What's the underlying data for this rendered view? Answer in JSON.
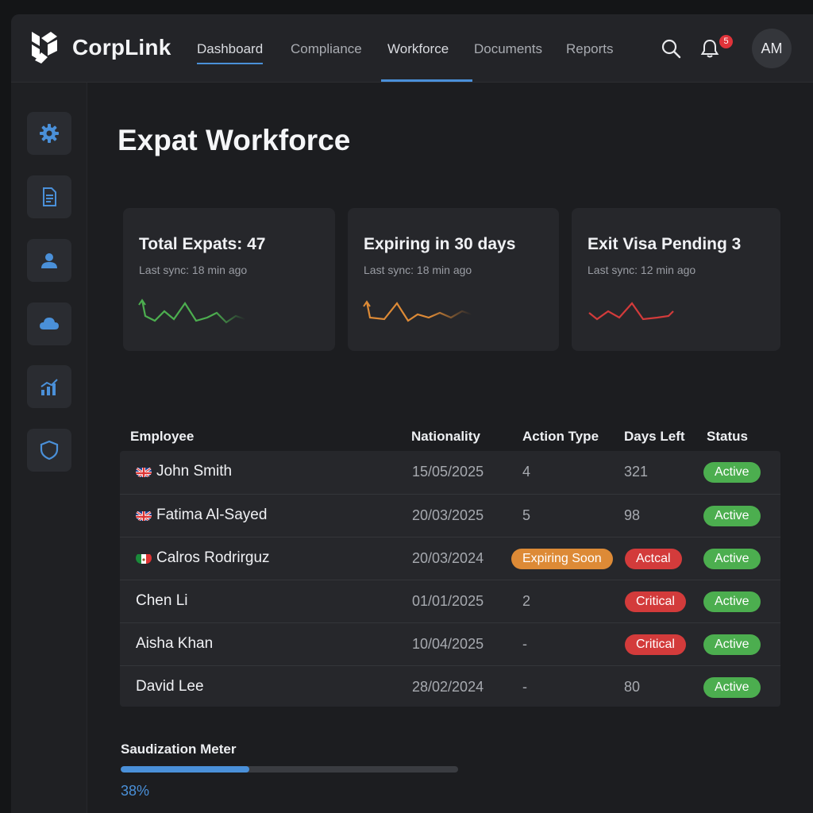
{
  "app": {
    "brand": "CorpLink"
  },
  "colors": {
    "accent": "#4a90d9",
    "green": "#4cae4f",
    "red": "#d33b3b",
    "orange": "#dd8a36"
  },
  "nav": {
    "items": [
      {
        "label": "Dashboard"
      },
      {
        "label": "Compliance"
      },
      {
        "label": "Workforce"
      },
      {
        "label": "Documents"
      },
      {
        "label": "Reports"
      }
    ],
    "active_underlined": "Dashboard",
    "active_tab": "Workforce"
  },
  "header": {
    "notification_count": "5",
    "avatar_initials": "AM"
  },
  "sidebar": {
    "items": [
      {
        "icon": "gear-icon"
      },
      {
        "icon": "document-icon"
      },
      {
        "icon": "user-icon"
      },
      {
        "icon": "cloud-icon"
      },
      {
        "icon": "chart-icon"
      },
      {
        "icon": "shield-icon"
      }
    ]
  },
  "page": {
    "title": "Expat Workforce"
  },
  "cards": [
    {
      "title": "Total Expats: 47",
      "subtitle": "Last sync: 18 min ago",
      "spark_color": "#4cae4f"
    },
    {
      "title": "Expiring in 30 days",
      "subtitle": "Last sync: 18 min ago",
      "spark_color": "#dd8a36"
    },
    {
      "title": "Exit Visa Pending 3",
      "subtitle": "Last sync: 12 min ago",
      "spark_color": "#d33b3b"
    }
  ],
  "table": {
    "headers": [
      "Employee",
      "Nationality",
      "Action Type",
      "Days Left",
      "Status"
    ],
    "rows": [
      {
        "employee": "John Smith",
        "flag": "uk",
        "nationality": "15/05/2025",
        "action": "4",
        "action_style": "text",
        "days": "321",
        "days_style": "text",
        "status": "Active"
      },
      {
        "employee": "Fatima Al-Sayed",
        "flag": "uk",
        "nationality": "20/03/2025",
        "action": "5",
        "action_style": "text",
        "days": "98",
        "days_style": "text",
        "status": "Active"
      },
      {
        "employee": "Calros Rodrirguz",
        "flag": "mx",
        "nationality": "20/03/2024",
        "action": "Expiring Soon",
        "action_style": "orange",
        "days": "Actcal",
        "days_style": "red",
        "status": "Active"
      },
      {
        "employee": "Chen Li",
        "flag": "",
        "nationality": "01/01/2025",
        "action": "2",
        "action_style": "text",
        "days": "Critical",
        "days_style": "red",
        "status": "Active"
      },
      {
        "employee": "Aisha Khan",
        "flag": "",
        "nationality": "10/04/2025",
        "action": "-",
        "action_style": "text",
        "days": "Critical",
        "days_style": "red",
        "status": "Active"
      },
      {
        "employee": "David Lee",
        "flag": "",
        "nationality": "28/02/2024",
        "action": "-",
        "action_style": "text",
        "days": "80",
        "days_style": "text",
        "status": "Active"
      }
    ]
  },
  "meter": {
    "label": "Saudization Meter",
    "value_text": "38%",
    "fraction": 0.38
  }
}
